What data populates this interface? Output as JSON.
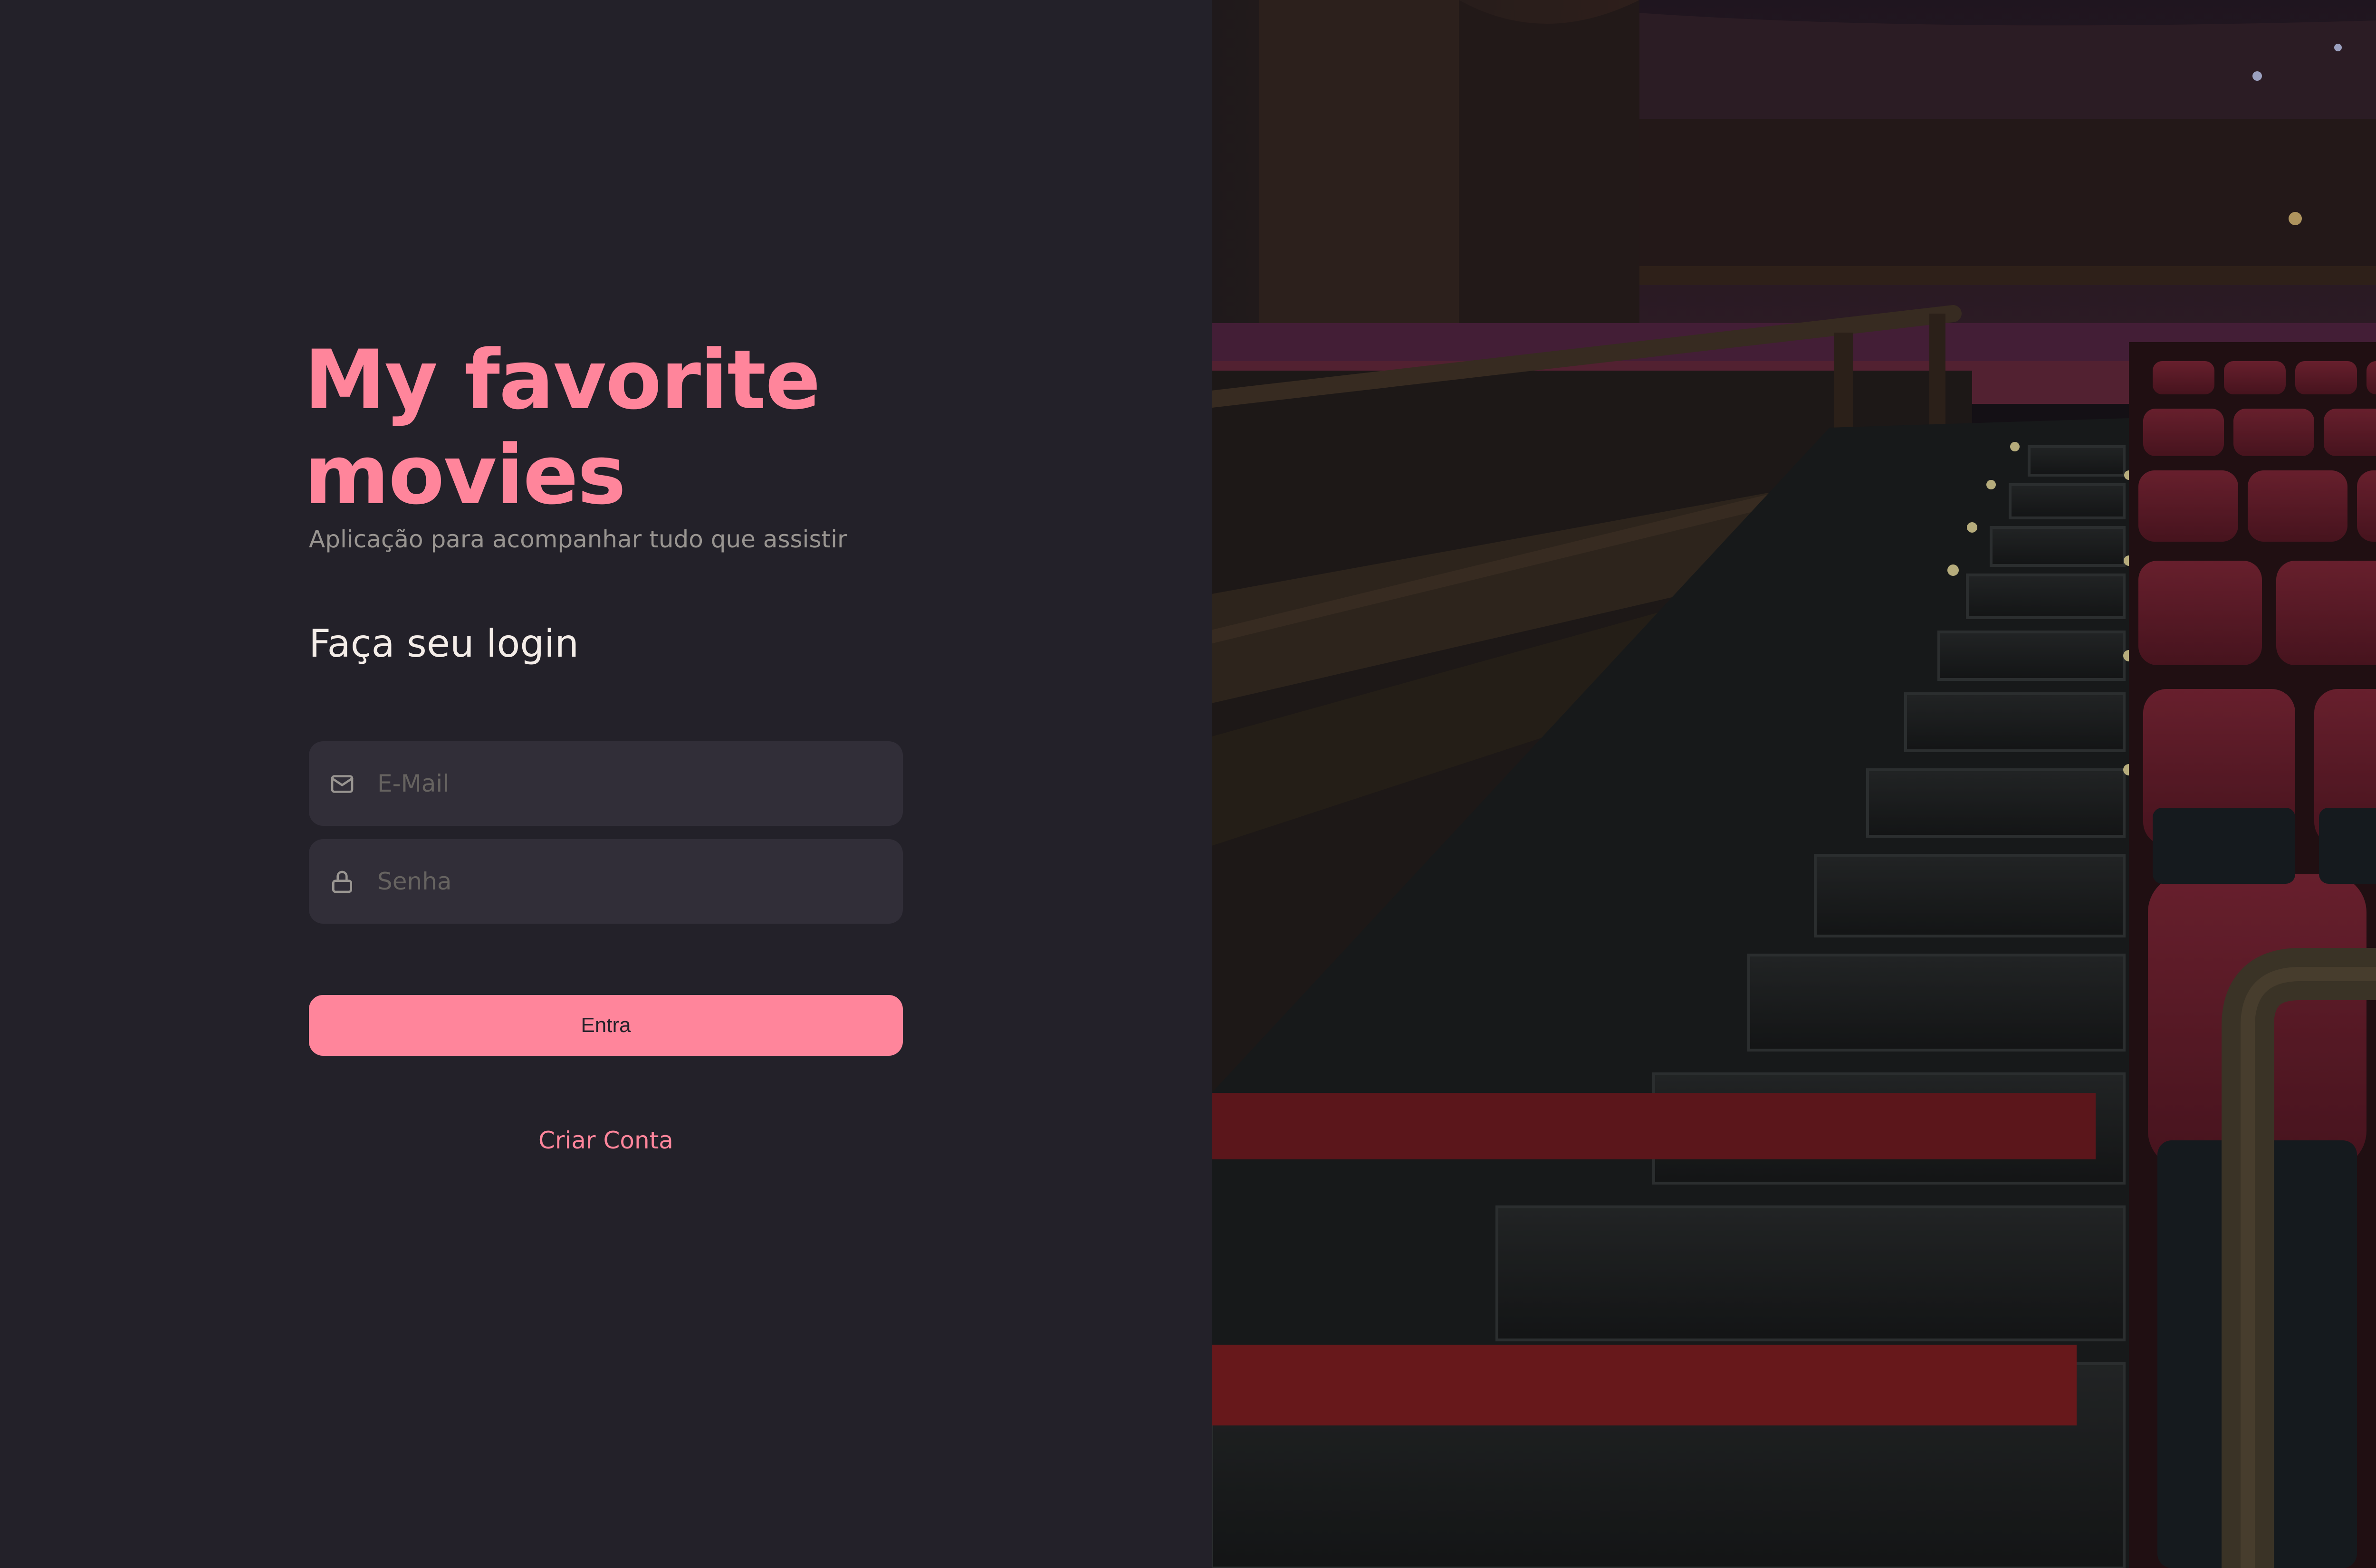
{
  "app": {
    "title": "My favorite movies",
    "subtitle": "Aplicação para acompanhar tudo que assistir"
  },
  "login": {
    "heading": "Faça seu login",
    "email": {
      "placeholder": "E-Mail",
      "value": "",
      "icon": "mail-icon"
    },
    "password": {
      "placeholder": "Senha",
      "value": "",
      "icon": "lock-icon"
    },
    "submit_label": "Entra",
    "create_account_label": "Criar Conta"
  },
  "background_image": {
    "subject": "cinema-auditorium-stairs-red-seats"
  },
  "colors": {
    "background": "#232129",
    "accent": "#FF859B",
    "input_background": "#312E38",
    "text_primary": "#F4EDE8",
    "text_muted": "#999591",
    "placeholder": "#666360"
  }
}
